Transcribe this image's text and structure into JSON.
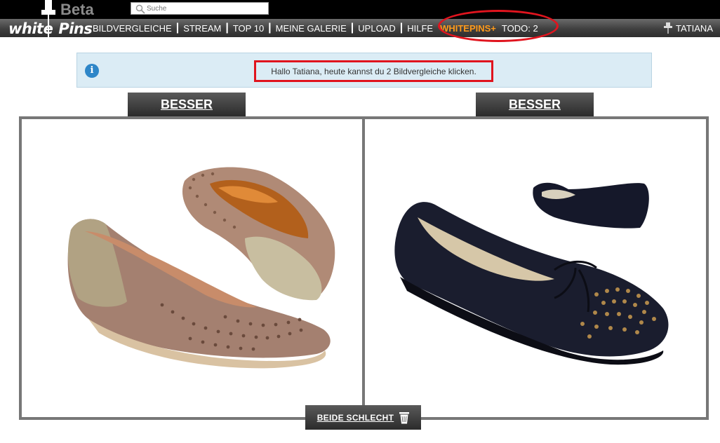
{
  "logo": {
    "beta": "Beta",
    "word1": "white",
    "word2": "Pins"
  },
  "search": {
    "placeholder": "Suche"
  },
  "nav": {
    "items": [
      "BILDVERGLEICHE",
      "STREAM",
      "TOP 10",
      "MEINE GALERIE",
      "UPLOAD",
      "HILFE"
    ],
    "plus": "WHITEPINS+",
    "todo": "TODO: 2",
    "user": "TATIANA"
  },
  "info": {
    "message": "Hallo Tatiana, heute kannst du 2 Bildvergleiche klicken."
  },
  "compare": {
    "better_left": "BESSER",
    "better_right": "BESSER",
    "both_bad": "BEIDE SCHLECHT"
  },
  "colors": {
    "accent": "#ff9a1a",
    "highlight": "#e0141e",
    "info_bg": "#dbecf5",
    "info_icon": "#2e86c8"
  }
}
